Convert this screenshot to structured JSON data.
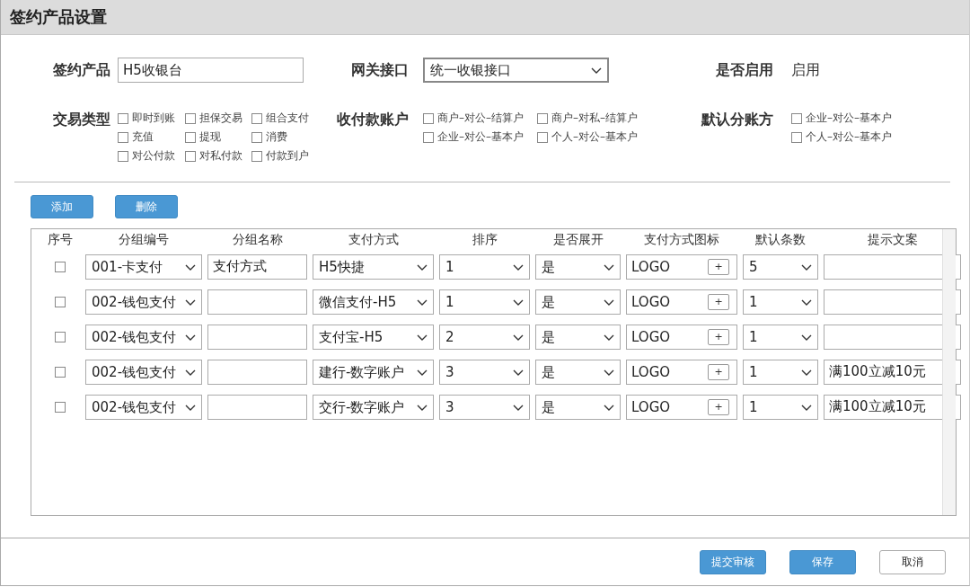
{
  "window": {
    "title": "签约产品设置"
  },
  "form": {
    "product": {
      "label": "签约产品",
      "value": "H5收银台"
    },
    "gateway": {
      "label": "网关接口",
      "value": "统一收银接口"
    },
    "enabled": {
      "label": "是否启用",
      "value": "启用"
    },
    "trade_types": {
      "label": "交易类型",
      "options": [
        {
          "label": "即时到账",
          "checked": false
        },
        {
          "label": "担保交易",
          "checked": false
        },
        {
          "label": "组合支付",
          "checked": false
        },
        {
          "label": "充值",
          "checked": false
        },
        {
          "label": "提现",
          "checked": false
        },
        {
          "label": "消费",
          "checked": false
        },
        {
          "label": "对公付款",
          "checked": false
        },
        {
          "label": "对私付款",
          "checked": false
        },
        {
          "label": "付款到户",
          "checked": false
        }
      ]
    },
    "accounts": {
      "label": "收付款账户",
      "options": [
        {
          "label": "商户–对公–结算户",
          "checked": false
        },
        {
          "label": "商户–对私–结算户",
          "checked": false
        },
        {
          "label": "企业–对公–基本户",
          "checked": false
        },
        {
          "label": "个人–对公–基本户",
          "checked": false
        }
      ]
    },
    "default_split": {
      "label": "默认分账方",
      "options": [
        {
          "label": "企业–对公–基本户",
          "checked": false
        },
        {
          "label": "个人–对公–基本户",
          "checked": false
        }
      ]
    }
  },
  "toolbar": [
    "添加",
    "删除"
  ],
  "table": {
    "columns": [
      "序号",
      "分组编号",
      "分组名称",
      "支付方式",
      "排序",
      "是否展开",
      "支付方式图标",
      "默认条数",
      "提示文案"
    ],
    "rows": [
      {
        "checked": false,
        "group": "001-卡支付",
        "name": "支付方式",
        "method": "H5快捷",
        "sort": "1",
        "expand": "是",
        "icon": "LOGO",
        "icon_button": "+",
        "count": "5",
        "hint": ""
      },
      {
        "checked": false,
        "group": "002-钱包支付",
        "name": "",
        "method": "微信支付-H5",
        "sort": "1",
        "expand": "是",
        "icon": "LOGO",
        "icon_button": "+",
        "count": "1",
        "hint": ""
      },
      {
        "checked": false,
        "group": "002-钱包支付",
        "name": "",
        "method": "支付宝-H5",
        "sort": "2",
        "expand": "是",
        "icon": "LOGO",
        "icon_button": "+",
        "count": "1",
        "hint": ""
      },
      {
        "checked": false,
        "group": "002-钱包支付",
        "name": "",
        "method": "建行-数字账户",
        "sort": "3",
        "expand": "是",
        "icon": "LOGO",
        "icon_button": "+",
        "count": "1",
        "hint": "满100立减10元"
      },
      {
        "checked": false,
        "group": "002-钱包支付",
        "name": "",
        "method": "交行-数字账户",
        "sort": "3",
        "expand": "是",
        "icon": "LOGO",
        "icon_button": "+",
        "count": "1",
        "hint": "满100立减10元"
      }
    ]
  },
  "footer_buttons": [
    {
      "label": "提交审核",
      "kind": "primary"
    },
    {
      "label": "保存",
      "kind": "primary"
    },
    {
      "label": "取消",
      "kind": "secondary"
    }
  ]
}
